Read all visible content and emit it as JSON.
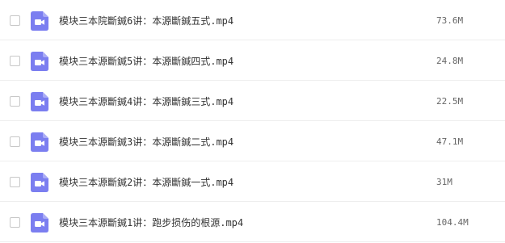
{
  "colors": {
    "video_icon": "#7b7ef0",
    "row_divider": "#eeeeee",
    "text": "#333333",
    "size_text": "#666666"
  },
  "file_list": {
    "columns": [
      "name",
      "size"
    ],
    "rows": [
      {
        "icon": "video-file-icon",
        "name": "模块三本院斷鍼6讲：本源斷鍼五式.mp4",
        "size": "73.6M"
      },
      {
        "icon": "video-file-icon",
        "name": "模块三本源斷鍼5讲：本源斷鍼四式.mp4",
        "size": "24.8M"
      },
      {
        "icon": "video-file-icon",
        "name": "模块三本源斷鍼4讲：本源斷鍼三式.mp4",
        "size": "22.5M"
      },
      {
        "icon": "video-file-icon",
        "name": "模块三本源斷鍼3讲：本源斷鍼二式.mp4",
        "size": "47.1M"
      },
      {
        "icon": "video-file-icon",
        "name": "模块三本源斷鍼2讲：本源斷鍼一式.mp4",
        "size": "31M"
      },
      {
        "icon": "video-file-icon",
        "name": "模块三本源斷鍼1讲：跑步损伤的根源.mp4",
        "size": "104.4M"
      }
    ]
  }
}
